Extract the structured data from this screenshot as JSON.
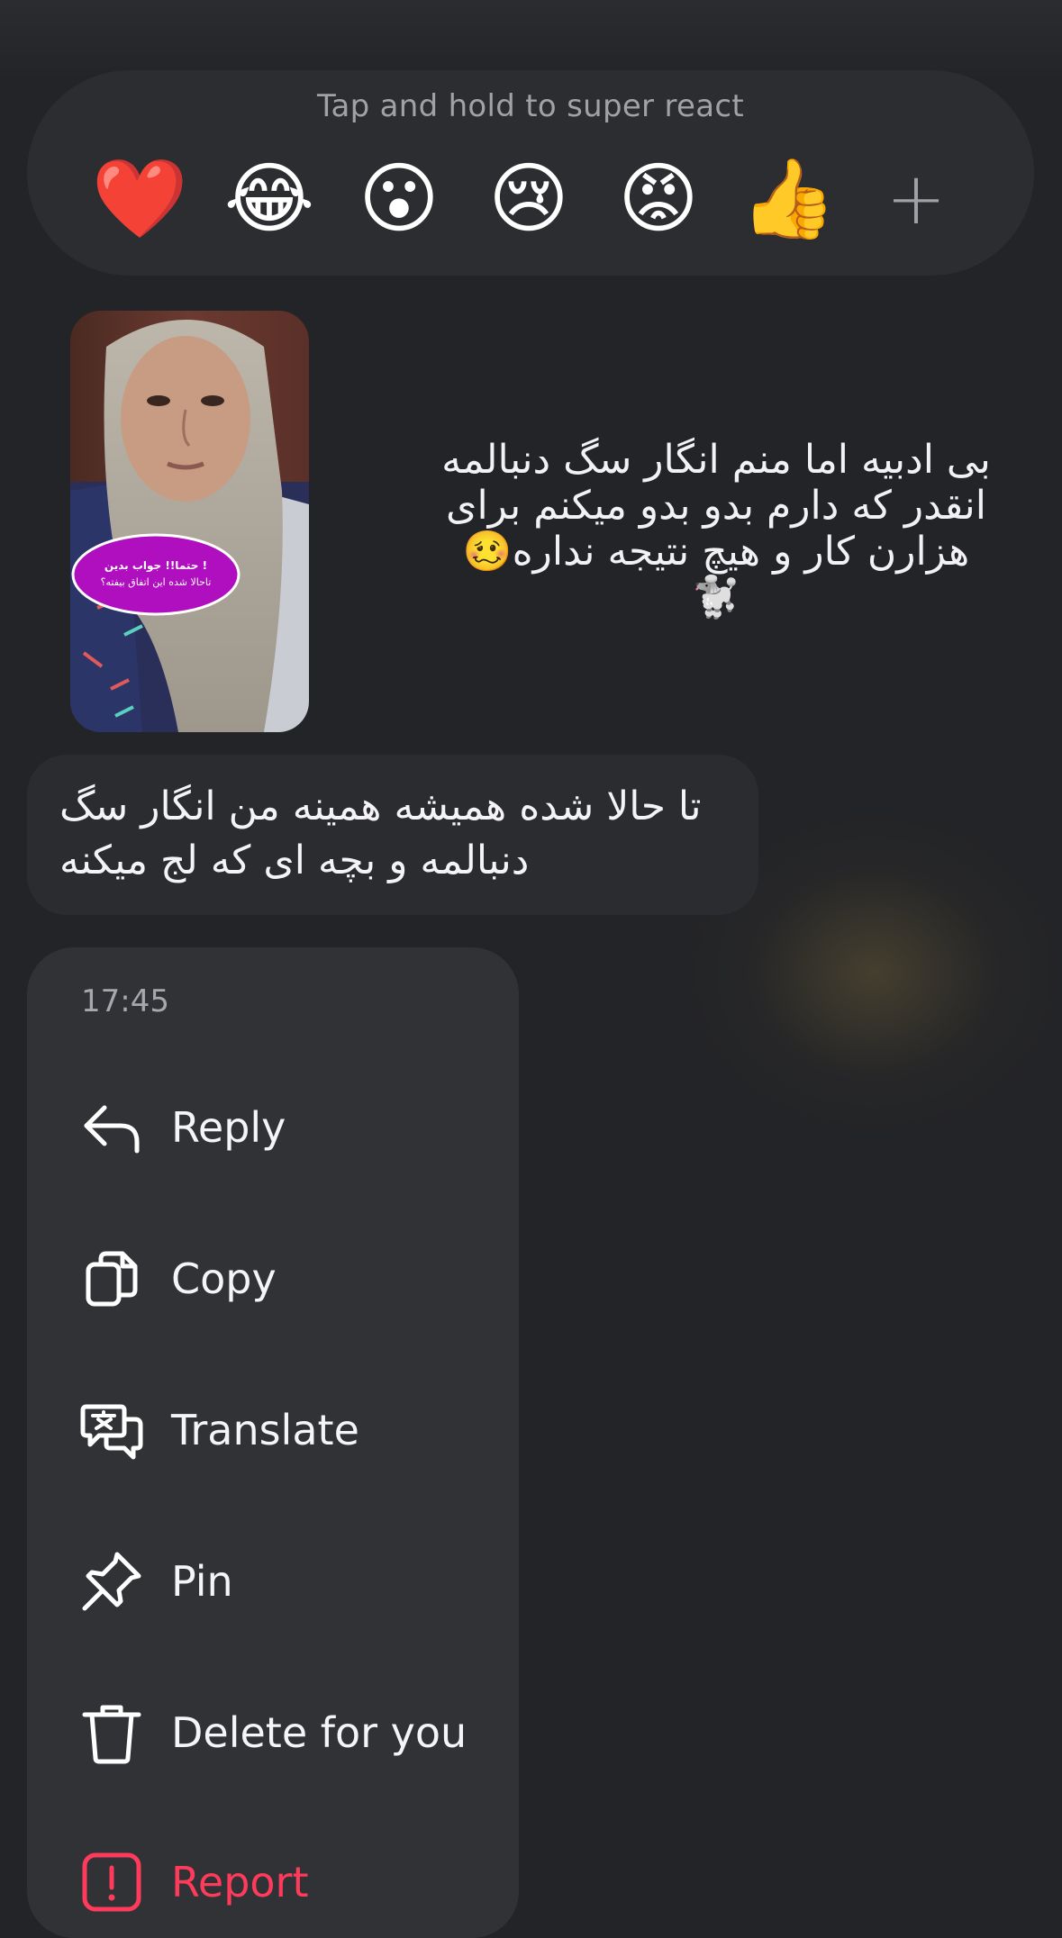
{
  "reactions": {
    "hint": "Tap and hold to super react",
    "emojis": [
      "❤️",
      "😂",
      "😮",
      "😢",
      "😡",
      "👍"
    ],
    "more_icon": "+"
  },
  "messages": {
    "media": {
      "sticker_line1": "حتما!! جواب بدین !",
      "sticker_line2": "تاحالا شده این اتفاق بیفته؟"
    },
    "received_text": "بی ادبیه اما منم انگار سگ دنبالمه انقدر که دارم بدو بدو میکنم برای هزارن کار و هیچ نتیجه نداره🥴🐩",
    "reply_text": "تا حالا شده همیشه همینه من انگار سگ دنبالمه و بچه ای که لج میکنه"
  },
  "menu": {
    "timestamp": "17:45",
    "items": [
      {
        "label": "Reply",
        "icon": "reply-icon"
      },
      {
        "label": "Copy",
        "icon": "copy-icon"
      },
      {
        "label": "Translate",
        "icon": "translate-icon"
      },
      {
        "label": "Pin",
        "icon": "pin-icon"
      },
      {
        "label": "Delete for you",
        "icon": "trash-icon"
      },
      {
        "label": "Report",
        "icon": "report-icon"
      }
    ]
  },
  "colors": {
    "background": "#232427",
    "menu": "#313236",
    "danger": "#ff3b5c",
    "sticker": "#b00fbf"
  }
}
